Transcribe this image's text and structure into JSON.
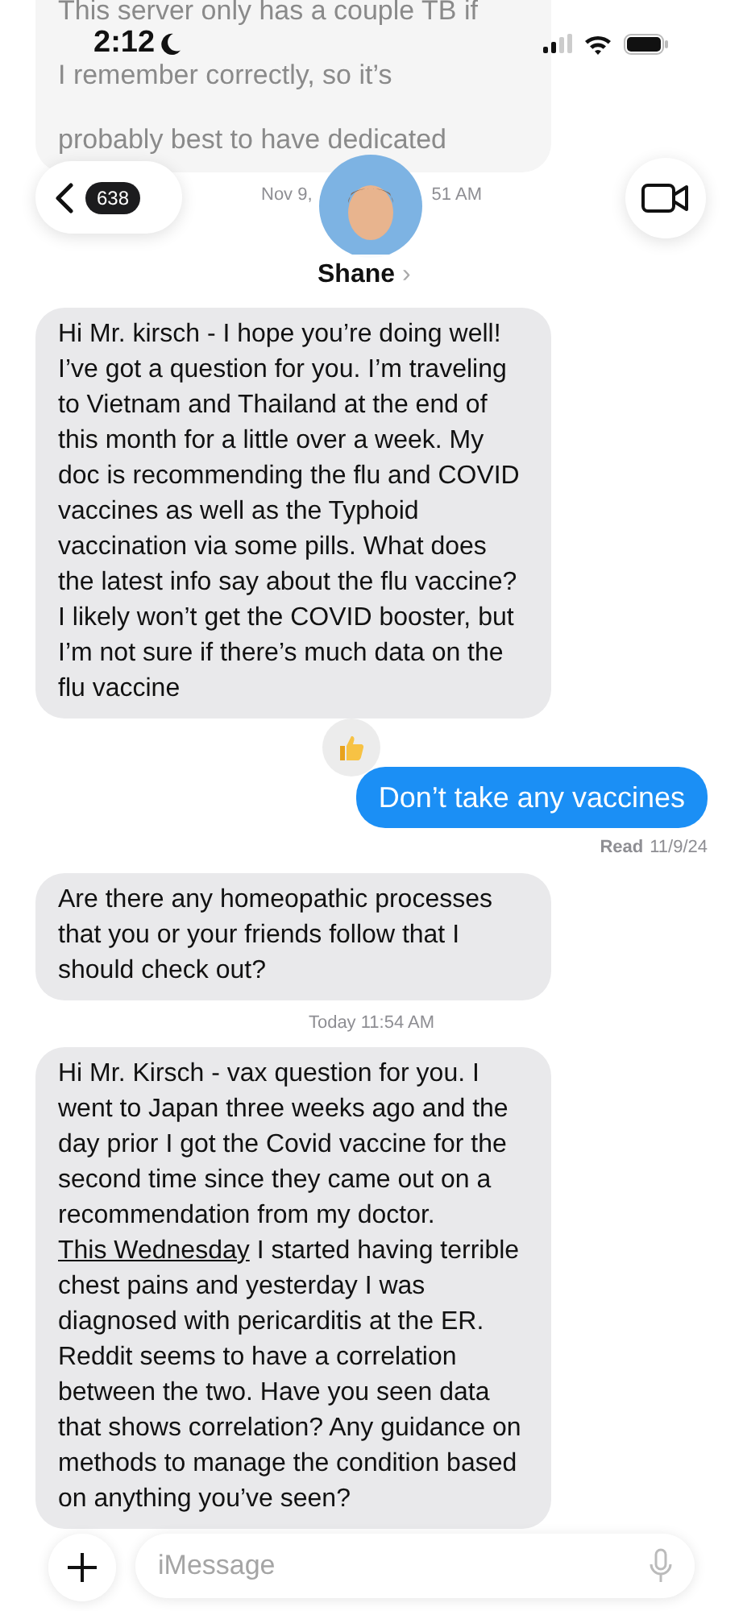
{
  "status_bar": {
    "time": "2:12",
    "focus_on": true
  },
  "header": {
    "back_count": "638",
    "contact_name": "Shane",
    "chevron": "›"
  },
  "messages": [
    {
      "kind": "incoming",
      "faded": true,
      "segments": [
        {
          "text": "This server only has a couple TB if I remember correctly, so it’s probably best to have dedicated",
          "link": false
        }
      ]
    },
    {
      "kind": "timestamp",
      "parts": [
        "Nov 9,",
        "51 AM"
      ]
    },
    {
      "kind": "incoming",
      "faded": false,
      "segments": [
        {
          "text": "Hi Mr. kirsch - I hope you’re doing well! I’ve got a question for you. I’m traveling to Vietnam and Thailand at the end of this month for a little over a week. My doc is recommending the flu and COVID vaccines as well as the Typhoid vaccination via some pills. What does the latest info say about the flu vaccine? I likely won’t get the COVID booster, but I’m not sure if there’s much data on the flu vaccine",
          "link": false
        }
      ]
    },
    {
      "kind": "outgoing",
      "reacted": true,
      "segments": [
        {
          "text": "Don’t take any vaccines",
          "link": false
        }
      ]
    },
    {
      "kind": "receipt",
      "label": "Read",
      "date": "11/9/24"
    },
    {
      "kind": "incoming",
      "faded": false,
      "segments": [
        {
          "text": "Are there any homeopathic processes that you or your friends follow that I should check out?",
          "link": false
        }
      ]
    },
    {
      "kind": "timestamp",
      "parts": [
        "Today 11:54 AM"
      ]
    },
    {
      "kind": "incoming",
      "faded": false,
      "segments": [
        {
          "text": "Hi Mr. Kirsch - vax question for you. I went to Japan three weeks ago and the day prior I got the Covid vaccine for the second time since they came out on a recommendation from my doctor. ",
          "link": false
        },
        {
          "text": "This Wednesday",
          "link": true
        },
        {
          "text": " I started having terrible chest pains and yesterday I was diagnosed with pericarditis at the ER. Reddit seems to have a correlation between the two. Have you seen data that shows correlation? Any guidance on methods to manage the condition based on anything you’ve seen?",
          "link": false
        }
      ]
    }
  ],
  "composer": {
    "placeholder": "iMessage"
  }
}
